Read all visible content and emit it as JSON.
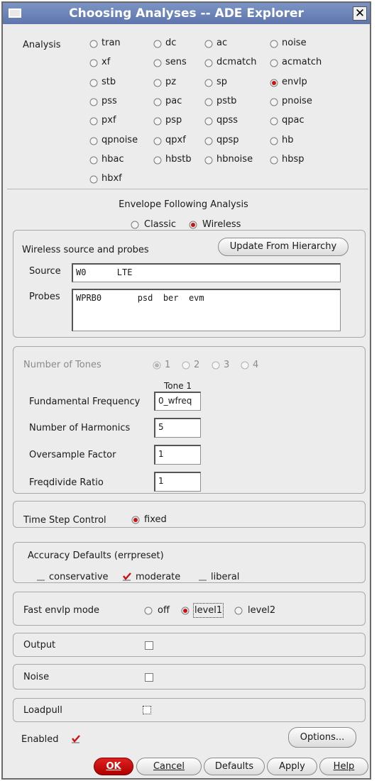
{
  "window": {
    "title": "Choosing Analyses -- ADE Explorer",
    "close_glyph": "✕"
  },
  "analysis": {
    "label": "Analysis",
    "selected": "envlp",
    "options": [
      "tran",
      "dc",
      "ac",
      "noise",
      "xf",
      "sens",
      "dcmatch",
      "acmatch",
      "stb",
      "pz",
      "sp",
      "envlp",
      "pss",
      "pac",
      "pstb",
      "pnoise",
      "pxf",
      "psp",
      "qpss",
      "qpac",
      "qpnoise",
      "qpxf",
      "qpsp",
      "hb",
      "hbac",
      "hbstb",
      "hbnoise",
      "hbsp",
      "hbxf"
    ]
  },
  "envelope": {
    "title": "Envelope Following Analysis",
    "classic_label": "Classic",
    "wireless_label": "Wireless",
    "selected": "Wireless"
  },
  "wireless": {
    "heading": "Wireless source and probes",
    "update_button": "Update From Hierarchy",
    "source_label": "Source",
    "source_value": "W0      LTE",
    "probes_label": "Probes",
    "probes_value": "WPRB0       psd  ber  evm"
  },
  "tones": {
    "label": "Number of Tones",
    "options": [
      "1",
      "2",
      "3",
      "4"
    ],
    "selected": "1",
    "column_header": "Tone 1",
    "fundamental_label": "Fundamental Frequency",
    "fundamental_value": "0_wfreq",
    "harmonics_label": "Number of Harmonics",
    "harmonics_value": "5",
    "oversample_label": "Oversample Factor",
    "oversample_value": "1",
    "freqdivide_label": "Freqdivide Ratio",
    "freqdivide_value": "1"
  },
  "timestep": {
    "label": "Time Step Control",
    "option_label": "fixed"
  },
  "accuracy": {
    "label": "Accuracy Defaults (errpreset)",
    "conservative": "conservative",
    "moderate": "moderate",
    "liberal": "liberal",
    "checked": "moderate"
  },
  "fastmode": {
    "label": "Fast envlp mode",
    "off": "off",
    "level1": "level1",
    "level2": "level2",
    "selected": "level1"
  },
  "output": {
    "label": "Output"
  },
  "noise": {
    "label": "Noise"
  },
  "loadpull": {
    "label": "Loadpull"
  },
  "enabled": {
    "label": "Enabled",
    "checked": true
  },
  "buttons": {
    "options": "Options...",
    "ok": "OK",
    "cancel": "Cancel",
    "defaults": "Defaults",
    "apply": "Apply",
    "help": "Help"
  },
  "colors": {
    "accent_red": "#cc1111",
    "title_bar": "#6a82b9"
  }
}
